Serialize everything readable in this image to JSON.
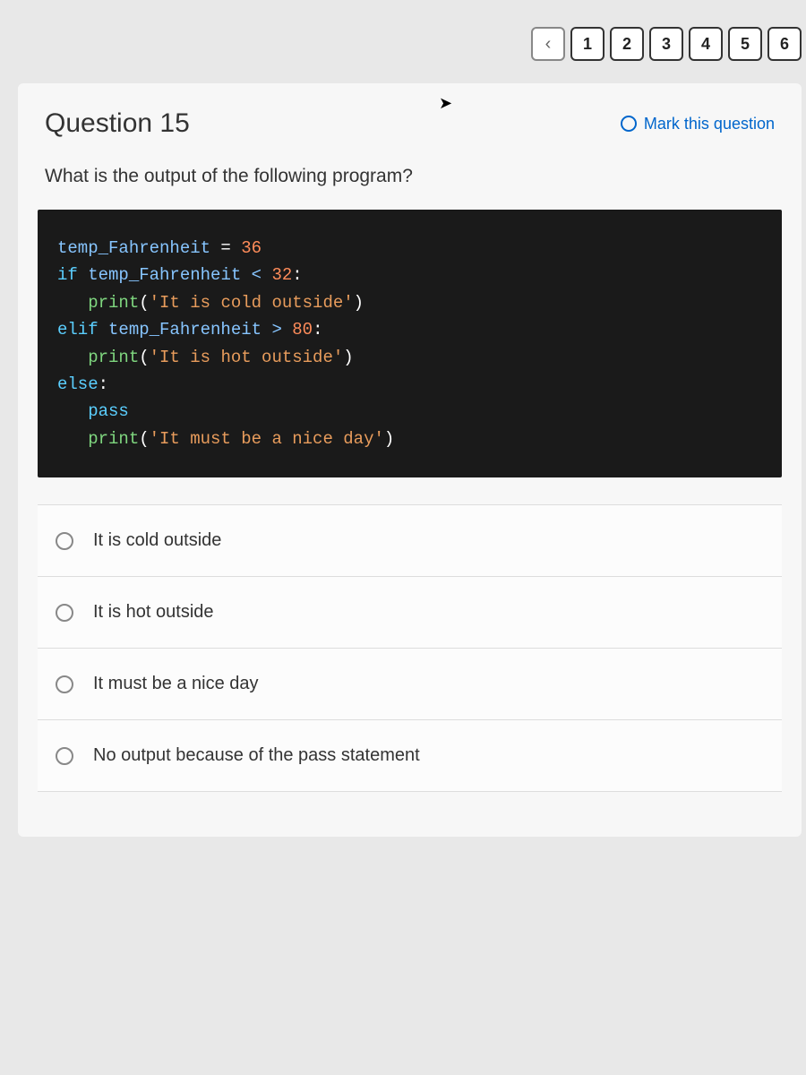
{
  "nav": {
    "pages": [
      "1",
      "2",
      "3",
      "4",
      "5",
      "6"
    ]
  },
  "question": {
    "title": "Question 15",
    "mark_label": "Mark this question",
    "prompt": "What is the output of the following program?"
  },
  "code": {
    "line1_a": "temp_Fahrenheit",
    "line1_b": " = ",
    "line1_c": "36",
    "line2_a": "if",
    "line2_b": " temp_Fahrenheit < ",
    "line2_c": "32",
    "line2_d": ":",
    "line3_a": "   print",
    "line3_b": "(",
    "line3_c": "'It is cold outside'",
    "line3_d": ")",
    "line4_a": "elif",
    "line4_b": " temp_Fahrenheit > ",
    "line4_c": "80",
    "line4_d": ":",
    "line5_a": "   print",
    "line5_b": "(",
    "line5_c": "'It is hot outside'",
    "line5_d": ")",
    "line6_a": "else",
    "line6_b": ":",
    "line7_a": "   pass",
    "line8_a": "   print",
    "line8_b": "(",
    "line8_c": "'It must be a nice day'",
    "line8_d": ")"
  },
  "answers": {
    "a": "It is cold outside",
    "b": "It is hot outside",
    "c": "It must be a nice day",
    "d": "No output because of the pass statement"
  }
}
